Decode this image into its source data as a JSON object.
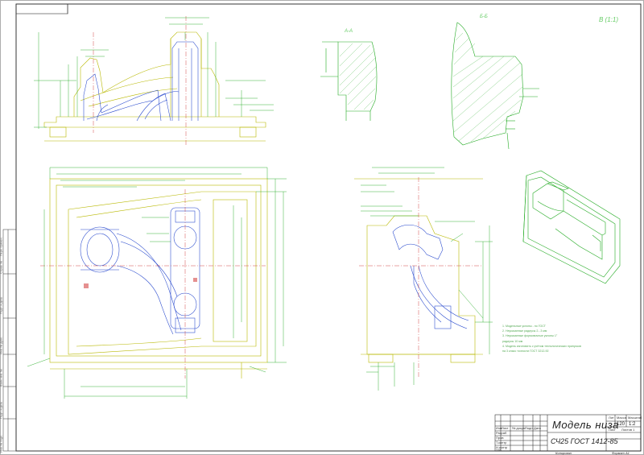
{
  "title_block": {
    "part_name": "Модель низа",
    "material": "СЧ25 ГОСТ 1412-85",
    "mass": "120",
    "scale": "1:2",
    "small_labels": [
      "Лит",
      "Масса",
      "Масштаб",
      "Лист",
      "Листов 1",
      "Изм",
      "Лист",
      "№ докум",
      "Подп",
      "Дата",
      "Разраб",
      "Пров",
      "Т.контр",
      "Н.контр",
      "Утв"
    ]
  },
  "footer": {
    "copied": "Копировал",
    "format": "Формат А1"
  },
  "sections": {
    "a": "А-А",
    "b": "Б-Б",
    "c": "В (1:1)"
  },
  "notes": [
    "1. Модельные уклоны - по ГОСТ",
    "2. Неуказанные радиусы 2...3 мм",
    "3. Неуказанные формовочные уклоны 1°",
    "   радиусы 10 мм",
    "4. Модель изготовить с учётом технологических припусков",
    "   на 3 класс точности ГОСТ 3212-92"
  ],
  "side_stamp": [
    "Инв. № подл.",
    "Подп. и дата",
    "Взам. инв. №",
    "Инв. № дубл.",
    "Подп. и дата",
    "Справ. №",
    "Перв. примен."
  ],
  "colors": {
    "outline": "#b8b800",
    "dims": "#22aa22",
    "part": "#2222cc",
    "frame": "#333333",
    "axis": "#cc2222",
    "hatch": "#55bb55"
  }
}
